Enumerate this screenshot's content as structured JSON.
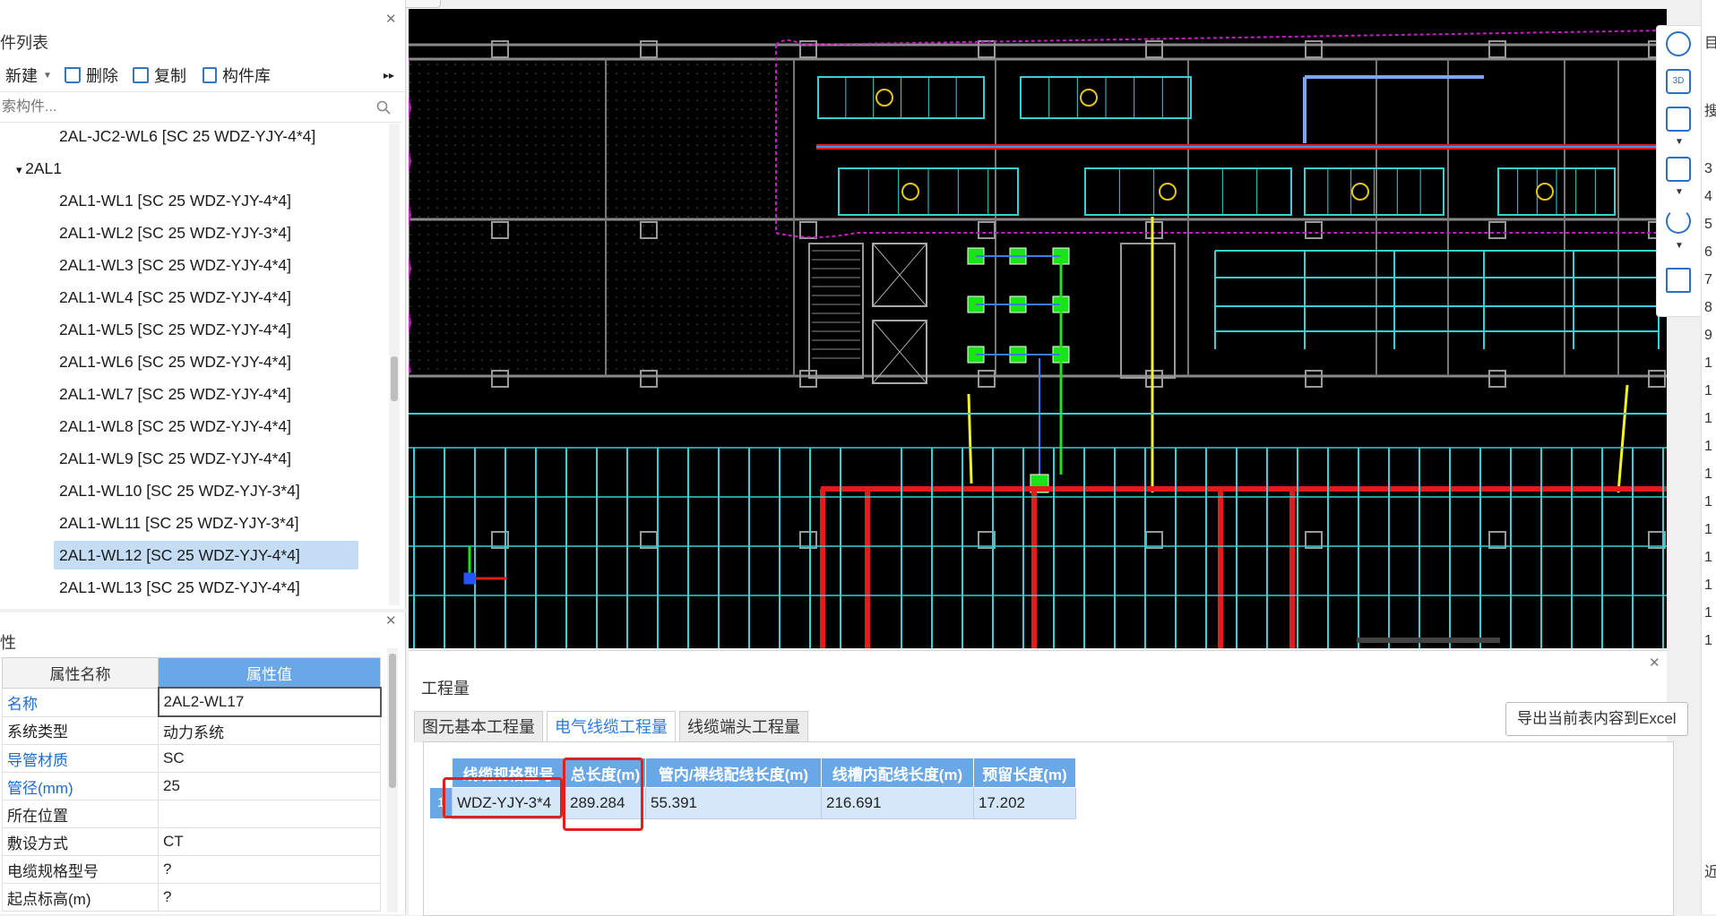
{
  "component_list": {
    "title": "件列表",
    "toolbar": {
      "new": "新建",
      "delete": "删除",
      "copy": "复制",
      "library": "构件库",
      "more": "▸▸"
    },
    "search_placeholder": "索构件...",
    "items": [
      {
        "label": "2AL-JC2-WL6 [SC 25 WDZ-YJY-4*4]",
        "level": 2,
        "selected": false
      },
      {
        "label": "2AL1",
        "level": 1,
        "group": true,
        "selected": false
      },
      {
        "label": "2AL1-WL1 [SC 25 WDZ-YJY-4*4]",
        "level": 2,
        "selected": false
      },
      {
        "label": "2AL1-WL2 [SC 25 WDZ-YJY-3*4]",
        "level": 2,
        "selected": false
      },
      {
        "label": "2AL1-WL3 [SC 25 WDZ-YJY-4*4]",
        "level": 2,
        "selected": false
      },
      {
        "label": "2AL1-WL4 [SC 25 WDZ-YJY-4*4]",
        "level": 2,
        "selected": false
      },
      {
        "label": "2AL1-WL5 [SC 25 WDZ-YJY-4*4]",
        "level": 2,
        "selected": false
      },
      {
        "label": "2AL1-WL6 [SC 25 WDZ-YJY-4*4]",
        "level": 2,
        "selected": false
      },
      {
        "label": "2AL1-WL7 [SC 25 WDZ-YJY-4*4]",
        "level": 2,
        "selected": false
      },
      {
        "label": "2AL1-WL8 [SC 25 WDZ-YJY-4*4]",
        "level": 2,
        "selected": false
      },
      {
        "label": "2AL1-WL9 [SC 25 WDZ-YJY-4*4]",
        "level": 2,
        "selected": false
      },
      {
        "label": "2AL1-WL10 [SC 25 WDZ-YJY-3*4]",
        "level": 2,
        "selected": false
      },
      {
        "label": "2AL1-WL11 [SC 25 WDZ-YJY-3*4]",
        "level": 2,
        "selected": false
      },
      {
        "label": "2AL1-WL12 [SC 25 WDZ-YJY-4*4]",
        "level": 2,
        "selected": true
      },
      {
        "label": "2AL1-WL13 [SC 25 WDZ-YJY-4*4]",
        "level": 2,
        "selected": false
      }
    ]
  },
  "properties": {
    "title": "性",
    "header": {
      "name": "属性名称",
      "value": "属性值"
    },
    "rows": [
      {
        "name": "名称",
        "value": "2AL2-WL17",
        "blue": true,
        "selected": true
      },
      {
        "name": "系统类型",
        "value": "动力系统",
        "blue": false,
        "selected": false
      },
      {
        "name": "导管材质",
        "value": "SC",
        "blue": true,
        "selected": false
      },
      {
        "name": "管径(mm)",
        "value": "25",
        "blue": true,
        "selected": false
      },
      {
        "name": "所在位置",
        "value": "",
        "blue": false,
        "selected": false
      },
      {
        "name": "敷设方式",
        "value": "CT",
        "blue": false,
        "selected": false
      },
      {
        "name": "电缆规格型号",
        "value": "?",
        "blue": false,
        "selected": false
      },
      {
        "name": "起点标高(m)",
        "value": "?",
        "blue": false,
        "selected": false
      }
    ]
  },
  "view_toolbar": {
    "icons": [
      "orbit-icon",
      "view-3d-icon",
      "view-cube-icon",
      "view-box-icon",
      "rotate-icon",
      "layer-view-icon"
    ],
    "labels": {
      "view_3d": "3D"
    }
  },
  "right_strip_text": [
    "目",
    "搜",
    "3",
    "4",
    "5",
    "6",
    "7",
    "8",
    "9",
    "1",
    "1",
    "1",
    "1",
    "1",
    "1",
    "1",
    "1",
    "1",
    "1",
    "1",
    "近"
  ],
  "quantity": {
    "title": "工程量",
    "tabs": [
      {
        "label": "图元基本工程量",
        "active": false
      },
      {
        "label": "电气线缆工程量",
        "active": true
      },
      {
        "label": "线缆端头工程量",
        "active": false
      }
    ],
    "export_label": "导出当前表内容到Excel",
    "columns": [
      "线缆规格型号",
      "总长度(m)",
      "管内/裸线配线长度(m)",
      "线槽内配线长度(m)",
      "预留长度(m)"
    ],
    "rows": [
      {
        "index": "1",
        "cells": [
          "WDZ-YJY-3*4",
          "289.284",
          "55.391",
          "216.691",
          "17.202"
        ]
      }
    ]
  },
  "colors": {
    "accent": "#2c7be5",
    "header_blue": "#6aa7e6",
    "highlight_red": "#e0201d",
    "cad_background": "#000000",
    "wire_cyan": "#35d1d6",
    "wire_red": "#e21b1b",
    "wire_yellow": "#f2f22a",
    "equipment_green": "#18e418",
    "border_magenta": "#c21ec2"
  }
}
